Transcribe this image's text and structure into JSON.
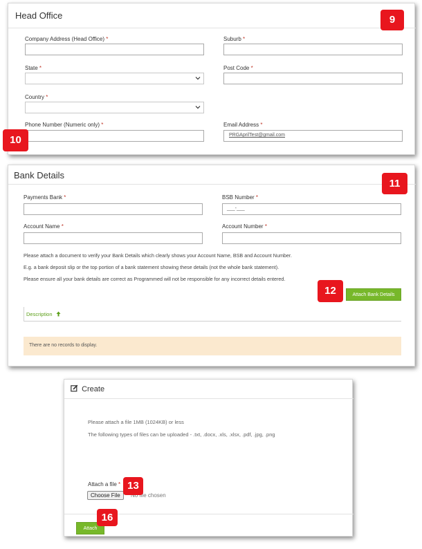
{
  "head_office": {
    "title": "Head Office",
    "company_address_label": "Company Address (Head Office)",
    "suburb_label": "Suburb",
    "state_label": "State",
    "post_code_label": "Post Code",
    "country_label": "Country",
    "phone_label": "Phone Number (Numeric only)",
    "email_label": "Email Address",
    "email_value": "PRGAprilTest@gmail.com",
    "required_mark": "*"
  },
  "bank_details": {
    "title": "Bank Details",
    "payments_bank_label": "Payments Bank",
    "bsb_label": "BSB Number",
    "bsb_placeholder": "___-___",
    "account_name_label": "Account Name",
    "account_number_label": "Account Number",
    "note_1": "Please attach a document to verify your Bank Details which clearly shows your Account Name, BSB and Account Number.",
    "note_2": "E.g. a bank deposit slip or the top portion of a bank statement showing these details (not the whole bank statement).",
    "note_3": "Please ensure all your bank details are correct as Programmed will not be responsible for any incorrect details entered.",
    "attach_button": "Attach Bank Details",
    "description_header": "Description",
    "empty_message": "There are no records to display."
  },
  "create_dialog": {
    "title": "Create",
    "note_1": "Please attach a file 1MB (1024KB) or less",
    "note_2": "The following types of files can be uploaded - .txt, .docx, .xls, .xlsx, .pdf, .jpg, .png",
    "attach_file_label": "Attach a file",
    "choose_file_button": "Choose File",
    "no_file_text": "No file chosen",
    "attach_button": "Attach"
  },
  "badges": [
    "9",
    "10",
    "11",
    "12",
    "13",
    "16"
  ],
  "colors": {
    "badge": "#e8161e",
    "accent_green": "#77b82a",
    "required": "#c0392b",
    "empty_bg": "#fbe9cf"
  }
}
